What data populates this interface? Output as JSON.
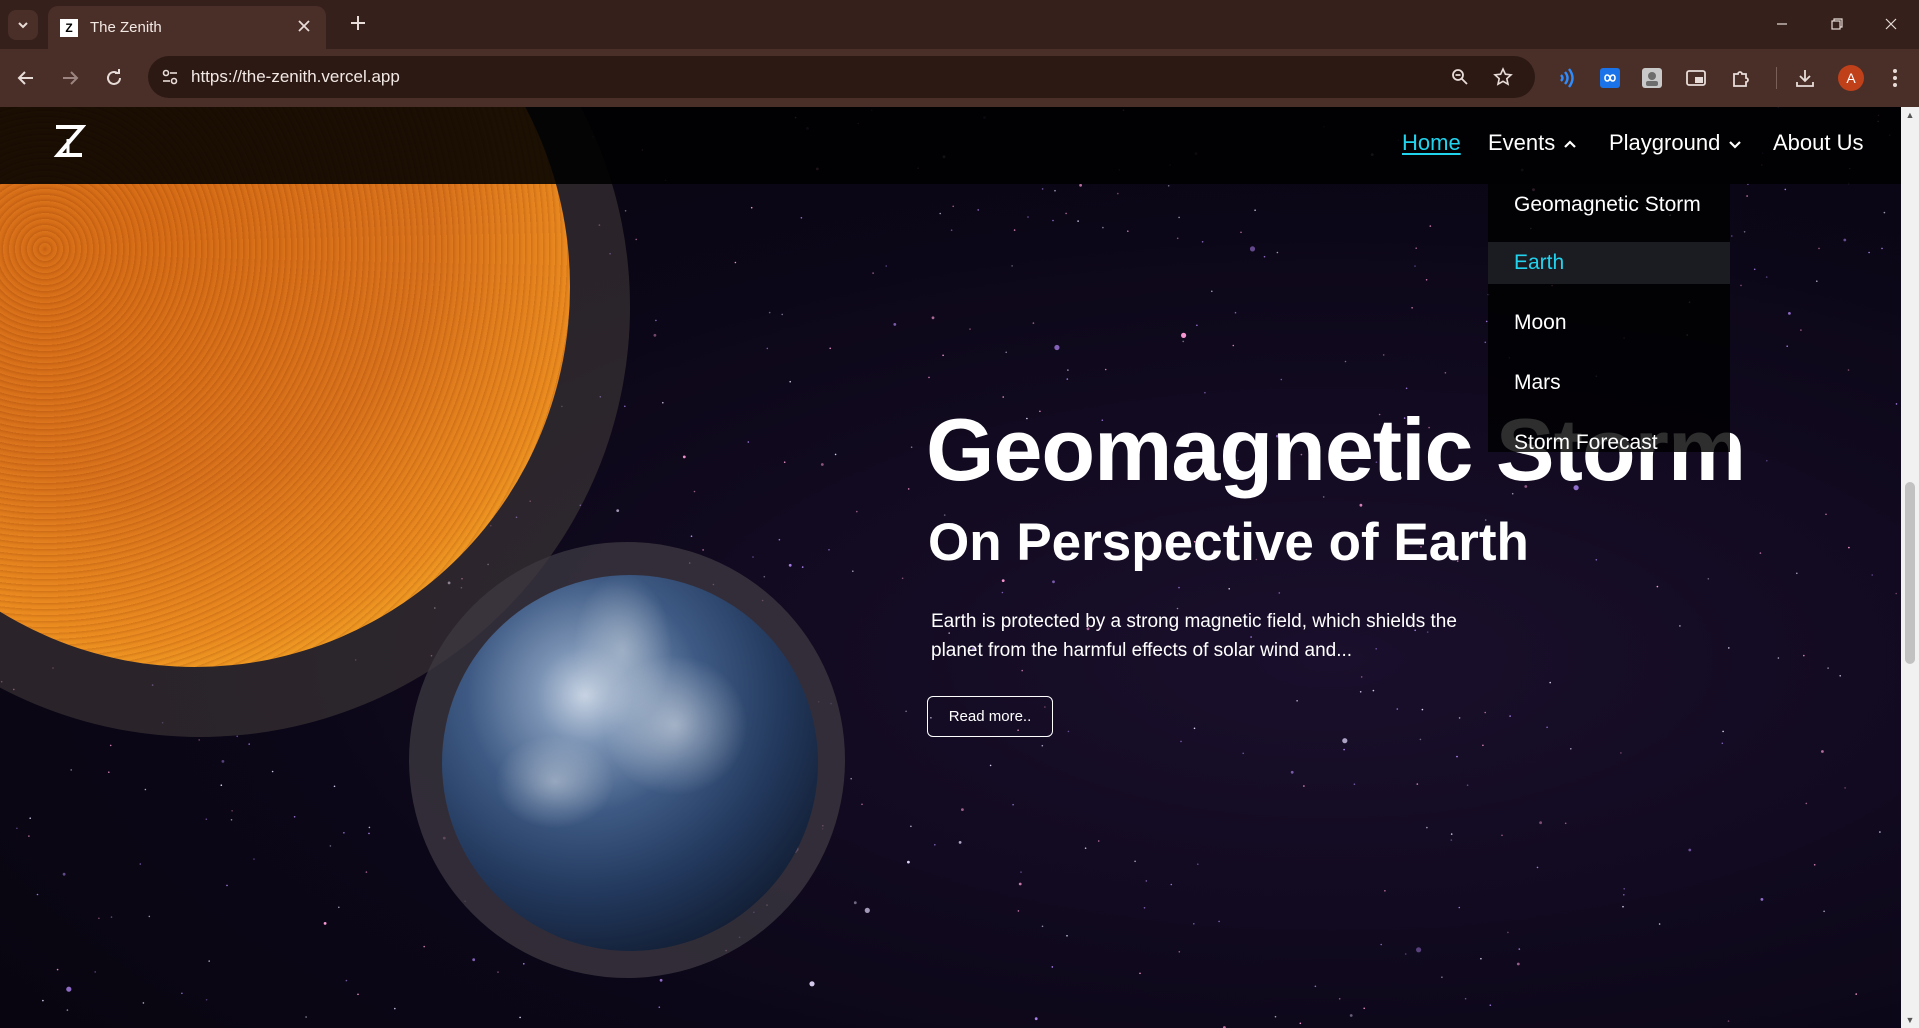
{
  "browser": {
    "tab_title": "The Zenith",
    "favicon_letter": "Z",
    "url": "https://the-zenith.vercel.app",
    "profile_initial": "A",
    "icons": {
      "tab_list": "chevron-down-icon",
      "close_tab": "close-icon",
      "new_tab": "plus-icon",
      "back": "arrow-left-icon",
      "forward": "arrow-right-icon",
      "reload": "reload-icon",
      "site_info": "tune-icon",
      "zoom": "zoom-icon",
      "bookmark": "star-icon",
      "downloads": "download-icon",
      "menu": "kebab-menu-icon"
    }
  },
  "site": {
    "nav": {
      "home": "Home",
      "events": "Events",
      "playground": "Playground",
      "about": "About Us"
    },
    "events_menu": [
      "Geomagnetic Storm",
      "Earth",
      "Moon",
      "Mars",
      "Storm Forecast"
    ],
    "active_event": "Earth",
    "hero": {
      "title": "Geomagnetic Storm",
      "subtitle": "On Perspective of Earth",
      "text": "Earth is protected by a strong magnetic field, which shields the planet from the harmful effects of solar wind and...",
      "button": "Read more.."
    }
  },
  "colors": {
    "accent": "#22d3ee",
    "chrome_dark": "#35201b",
    "chrome": "#4a2f28"
  }
}
